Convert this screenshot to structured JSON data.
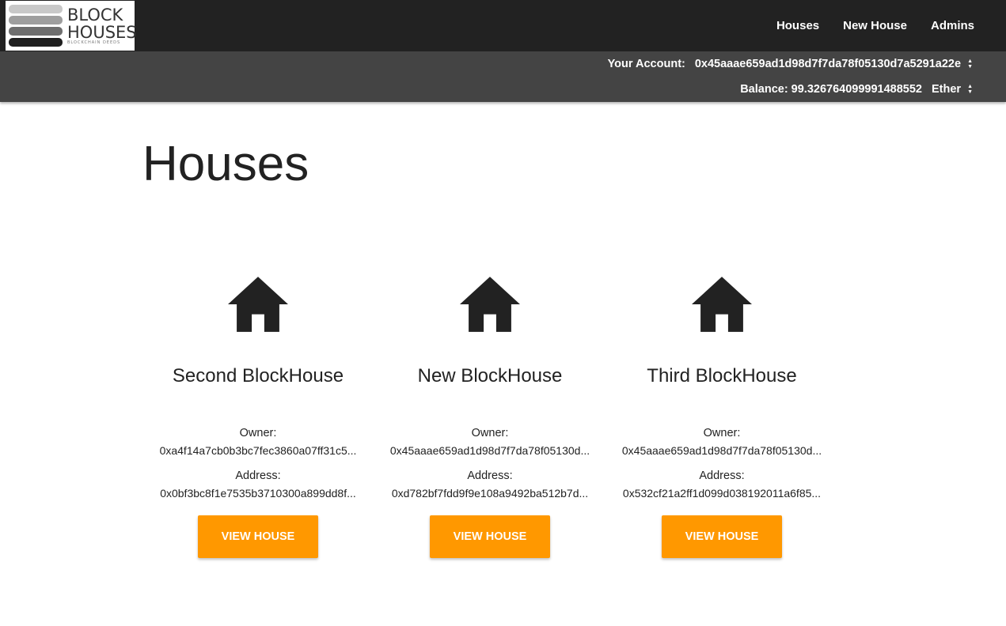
{
  "logo": {
    "line1": "BLOCK",
    "line2": "HOUSES",
    "tagline": "BLOCKCHAIN DEEDS"
  },
  "nav": {
    "items": [
      {
        "label": "Houses"
      },
      {
        "label": "New House"
      },
      {
        "label": "Admins"
      }
    ]
  },
  "account": {
    "label": "Your Account:",
    "value": "0x45aaae659ad1d98d7f7da78f05130d7a5291a22e",
    "balance_label": "Balance:",
    "balance_value": "99.326764099991488552",
    "unit": "Ether"
  },
  "page": {
    "title": "Houses"
  },
  "houses": [
    {
      "name": "Second BlockHouse",
      "owner_label": "Owner:",
      "owner": "0xa4f14a7cb0b3bc7fec3860a07ff31c5...",
      "address_label": "Address:",
      "address": "0x0bf3bc8f1e7535b3710300a899dd8f...",
      "button": "VIEW HOUSE"
    },
    {
      "name": "New BlockHouse",
      "owner_label": "Owner:",
      "owner": "0x45aaae659ad1d98d7f7da78f05130d...",
      "address_label": "Address:",
      "address": "0xd782bf7fdd9f9e108a9492ba512b7d...",
      "button": "VIEW HOUSE"
    },
    {
      "name": "Third BlockHouse",
      "owner_label": "Owner:",
      "owner": "0x45aaae659ad1d98d7f7da78f05130d...",
      "address_label": "Address:",
      "address": "0x532cf21a2ff1d099d038192011a6f85...",
      "button": "VIEW HOUSE"
    }
  ],
  "colors": {
    "topbar": "#222222",
    "subbar": "#444444",
    "accent": "#ff9800"
  }
}
